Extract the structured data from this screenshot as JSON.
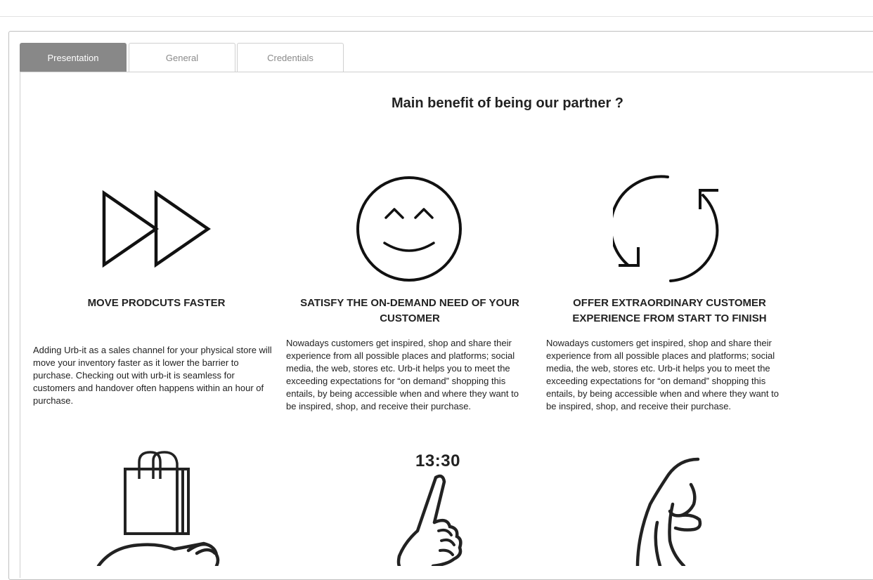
{
  "tabs": [
    {
      "label": "Presentation",
      "active": true
    },
    {
      "label": "General",
      "active": false
    },
    {
      "label": "Credentials",
      "active": false
    }
  ],
  "presentation": {
    "title": "Main benefit of being our partner ?",
    "features": [
      {
        "icon": "fast-forward-icon",
        "title": "MOVE PRODCUTS FASTER",
        "text": "Adding Urb-it as a sales channel for your physical store will move your inventory faster as it lower the barrier to purchase. Checking out with urb-it is seamless for customers and handover often happens within an hour of purchase."
      },
      {
        "icon": "smiley-face-icon",
        "title": "SATISFY THE ON-DEMAND NEED OF YOUR CUSTOMER",
        "text": "Nowadays customers get inspired, shop and share their experience from all possible places and platforms; social media, the web, stores etc. Urb-it helps you to meet the exceeding expectations for “on demand” shopping this entails, by being accessible when and where they want to be inspired, shop, and receive their purchase."
      },
      {
        "icon": "refresh-cycle-icon",
        "title": "OFFER EXTRAORDINARY CUSTOMER EXPERIENCE FROM START TO FINISH",
        "text": "Nowadays customers get inspired, shop and share their experience from all possible places and platforms; social media, the web, stores etc. Urb-it helps you to meet the exceeding expectations for “on demand” shopping this entails, by being accessible when and where they want to be inspired, shop, and receive their purchase."
      }
    ],
    "second_row_icons": [
      "shopping-bag-hand-icon",
      "pointing-hand-clock-icon",
      "handshake-icon"
    ],
    "clock_time": "13:30"
  }
}
